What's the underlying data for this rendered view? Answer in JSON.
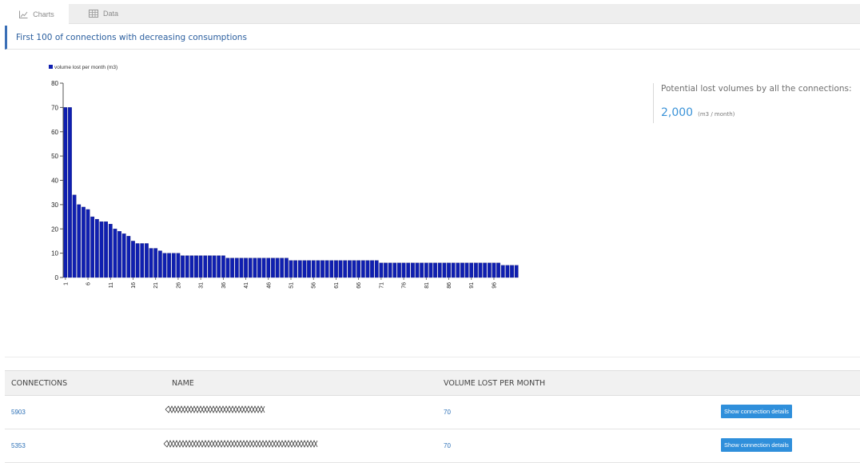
{
  "tabs": [
    {
      "label": "Charts",
      "icon": "line-chart-icon",
      "active": true
    },
    {
      "label": "Data",
      "icon": "table-icon",
      "active": false
    }
  ],
  "panel": {
    "title": "First 100 of connections with decreasing consumptions"
  },
  "summary": {
    "label": "Potential lost volumes by all the connections:",
    "value": "2,000",
    "unit": "(m3 / month)"
  },
  "chart_data": {
    "type": "bar",
    "title": "",
    "xlabel": "",
    "ylabel": "",
    "legend": {
      "label": "volume lost per month (m3)",
      "color": "#0f1fb0",
      "placement": "top-left"
    },
    "ylim": [
      0,
      80
    ],
    "yticks": [
      0,
      10,
      20,
      30,
      40,
      50,
      60,
      70,
      80
    ],
    "xtick_labels": [
      "1",
      "6",
      "11",
      "16",
      "21",
      "26",
      "31",
      "36",
      "41",
      "46",
      "51",
      "56",
      "61",
      "66",
      "71",
      "76",
      "81",
      "86",
      "91",
      "96"
    ],
    "categories": [
      "1",
      "2",
      "3",
      "4",
      "5",
      "6",
      "7",
      "8",
      "9",
      "10",
      "11",
      "12",
      "13",
      "14",
      "15",
      "16",
      "17",
      "18",
      "19",
      "20",
      "21",
      "22",
      "23",
      "24",
      "25",
      "26",
      "27",
      "28",
      "29",
      "30",
      "31",
      "32",
      "33",
      "34",
      "35",
      "36",
      "37",
      "38",
      "39",
      "40",
      "41",
      "42",
      "43",
      "44",
      "45",
      "46",
      "47",
      "48",
      "49",
      "50",
      "51",
      "52",
      "53",
      "54",
      "55",
      "56",
      "57",
      "58",
      "59",
      "60",
      "61",
      "62",
      "63",
      "64",
      "65",
      "66",
      "67",
      "68",
      "69",
      "70",
      "71",
      "72",
      "73",
      "74",
      "75",
      "76",
      "77",
      "78",
      "79",
      "80",
      "81",
      "82",
      "83",
      "84",
      "85",
      "86",
      "87",
      "88",
      "89",
      "90",
      "91",
      "92",
      "93",
      "94",
      "95",
      "96",
      "97",
      "98",
      "99",
      "100"
    ],
    "series": [
      {
        "name": "volume lost per month (m3)",
        "values": [
          70,
          70,
          34,
          30,
          29,
          28,
          25,
          24,
          23,
          23,
          22,
          20,
          19,
          18,
          17,
          15,
          14,
          14,
          14,
          12,
          12,
          11,
          10,
          10,
          10,
          10,
          9,
          9,
          9,
          9,
          9,
          9,
          9,
          9,
          9,
          9,
          8,
          8,
          8,
          8,
          8,
          8,
          8,
          8,
          8,
          8,
          8,
          8,
          8,
          8,
          7,
          7,
          7,
          7,
          7,
          7,
          7,
          7,
          7,
          7,
          7,
          7,
          7,
          7,
          7,
          7,
          7,
          7,
          7,
          7,
          6,
          6,
          6,
          6,
          6,
          6,
          6,
          6,
          6,
          6,
          6,
          6,
          6,
          6,
          6,
          6,
          6,
          6,
          6,
          6,
          6,
          6,
          6,
          6,
          6,
          6,
          6,
          5,
          5,
          5,
          5
        ]
      }
    ]
  },
  "table": {
    "headers": {
      "connections": "CONNECTIONS",
      "name": "NAME",
      "volume": "VOLUME LOST PER MONTH"
    },
    "rows": [
      {
        "connection": "5903",
        "volume": "70",
        "action": "Show connection details"
      },
      {
        "connection": "5353",
        "volume": "70",
        "action": "Show connection details"
      }
    ]
  }
}
